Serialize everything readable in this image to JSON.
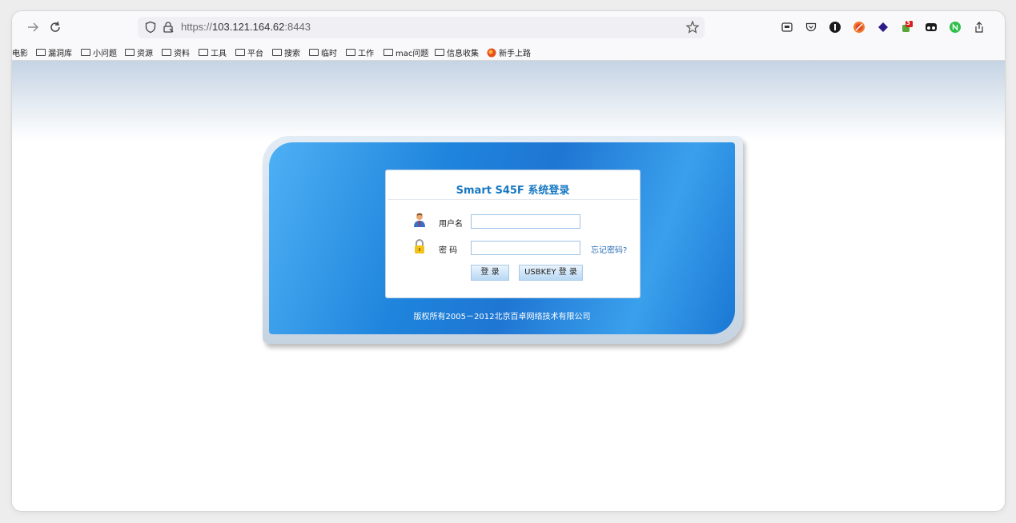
{
  "browser": {
    "url_protocol": "https://",
    "url_host": "103.121.164.62",
    "url_port": ":8443",
    "icons": [
      "back-arrow-icon",
      "reload-icon",
      "shield-icon",
      "lock-icon",
      "bookmark-star-icon"
    ]
  },
  "extensions": [
    {
      "name": "reader-icon",
      "badge": ""
    },
    {
      "name": "pocket-icon",
      "badge": ""
    },
    {
      "name": "onepassword-icon",
      "badge": ""
    },
    {
      "name": "blocker-icon",
      "badge": ""
    },
    {
      "name": "diamond-icon",
      "badge": ""
    },
    {
      "name": "notifier-icon",
      "badge": "3"
    },
    {
      "name": "glasses-icon",
      "badge": ""
    },
    {
      "name": "green-n-icon",
      "badge": ""
    },
    {
      "name": "share-icon",
      "badge": ""
    }
  ],
  "bookmarks": [
    {
      "label": "电影",
      "icon": "none"
    },
    {
      "label": "漏洞库",
      "icon": "folder-icon"
    },
    {
      "label": "小问题",
      "icon": "folder-icon"
    },
    {
      "label": "资源",
      "icon": "folder-icon"
    },
    {
      "label": "资料",
      "icon": "folder-icon"
    },
    {
      "label": "工具",
      "icon": "folder-icon"
    },
    {
      "label": "平台",
      "icon": "folder-icon"
    },
    {
      "label": "搜索",
      "icon": "folder-icon"
    },
    {
      "label": "临时",
      "icon": "folder-icon"
    },
    {
      "label": "工作",
      "icon": "folder-icon"
    },
    {
      "label": "mac问题",
      "icon": "folder-icon"
    },
    {
      "label": "信息收集",
      "icon": "folder-icon"
    },
    {
      "label": "新手上路",
      "icon": "firefox-icon"
    }
  ],
  "login": {
    "title": "Smart S45F 系统登录",
    "username_label": "用户名",
    "username_value": "",
    "password_label": "密 码",
    "password_value": "",
    "forgot_label": "忘记密码?",
    "login_button": "登 录",
    "usbkey_button": "USBKEY 登 录",
    "copyright": "版权所有2005－2012北京百卓网络技术有限公司"
  },
  "colors": {
    "title": "#1677c2",
    "panel_blue": "#1f76d3",
    "link": "#2a6db6"
  }
}
